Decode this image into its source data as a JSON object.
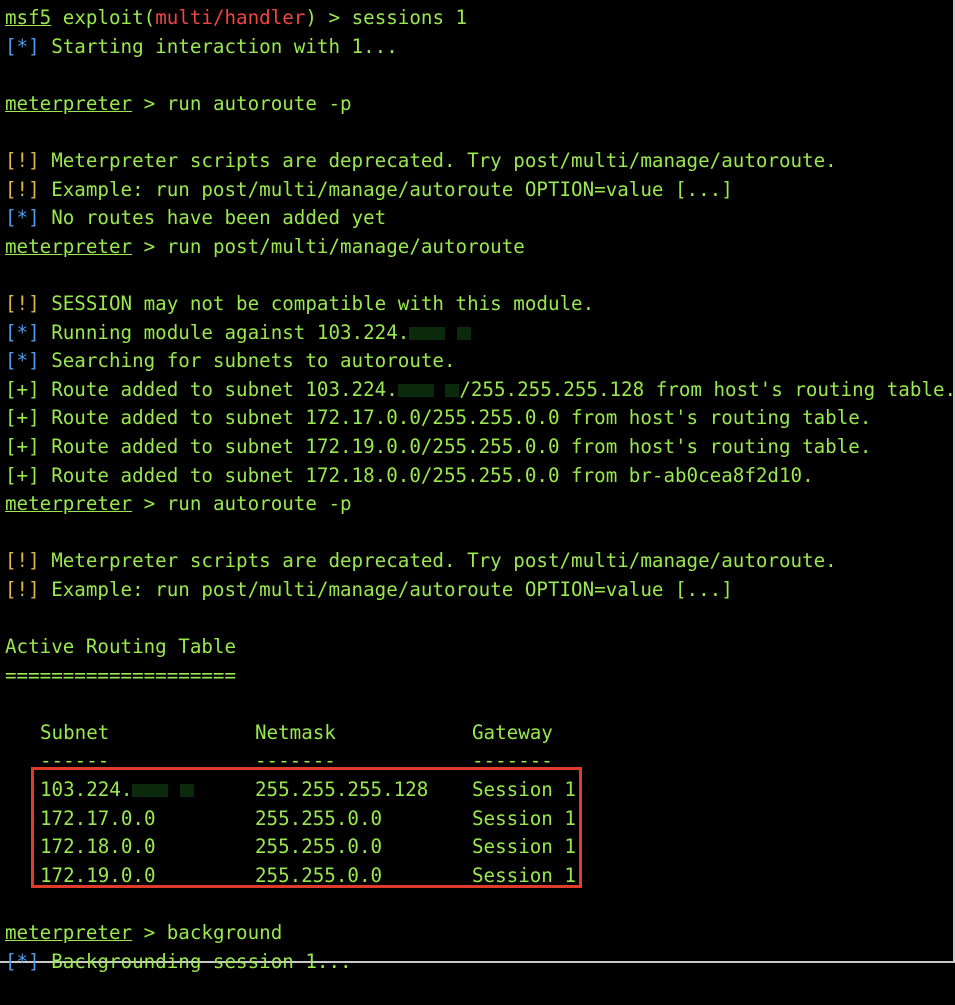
{
  "colors": {
    "background": "#000000",
    "text_green": "#9ae84f",
    "red": "#ee4444",
    "info_blue": "#4f9be8",
    "warn_yellow": "#d9b54a",
    "highlight_border": "#e03a2a"
  },
  "prompts": {
    "msf": "msf5",
    "exploit_pre": " exploit(",
    "exploit_module": "multi/handler",
    "exploit_post": ") > ",
    "meterpreter": "meterpreter",
    "mp_sep": " > "
  },
  "tags": {
    "info": "[*]",
    "warn": "[!]",
    "good": "[+]"
  },
  "lines": {
    "cmd_sessions": "sessions 1",
    "starting": " Starting interaction with 1...",
    "cmd_autoroute_p": "run autoroute -p",
    "warn_deprecated": " Meterpreter scripts are deprecated. Try post/multi/manage/autoroute.",
    "warn_example": " Example: run post/multi/manage/autoroute OPTION=value [...]",
    "no_routes": " No routes have been added yet",
    "cmd_post_autoroute": "run post/multi/manage/autoroute",
    "warn_session": " SESSION may not be compatible with this module.",
    "running_pre": " Running module against 103.224.",
    "searching": " Searching for subnets to autoroute.",
    "route1_pre": " Route added to subnet 103.224.",
    "route1_post": "/255.255.255.128 from host's routing table.",
    "route2": " Route added to subnet 172.17.0.0/255.255.0.0 from host's routing table.",
    "route3": " Route added to subnet 172.19.0.0/255.255.0.0 from host's routing table.",
    "route4": " Route added to subnet 172.18.0.0/255.255.0.0 from br-ab0cea8f2d10.",
    "cmd_autoroute_p2": "run autoroute -p",
    "warn_deprecated2": " Meterpreter scripts are deprecated. Try post/multi/manage/autoroute.",
    "warn_example2": " Example: run post/multi/manage/autoroute OPTION=value [...]",
    "table_title": "Active Routing Table",
    "table_underline": "====================",
    "cmd_background": "background",
    "backgrounding": " Backgrounding session 1..."
  },
  "routing_table": {
    "headers": [
      "Subnet",
      "Netmask",
      "Gateway"
    ],
    "header_underlines": [
      "------",
      "-------",
      "-------"
    ],
    "rows": [
      {
        "subnet": "103.224.",
        "netmask": "255.255.255.128",
        "gateway": "Session 1"
      },
      {
        "subnet": "172.17.0.0",
        "netmask": "255.255.0.0",
        "gateway": "Session 1"
      },
      {
        "subnet": "172.18.0.0",
        "netmask": "255.255.0.0",
        "gateway": "Session 1"
      },
      {
        "subnet": "172.19.0.0",
        "netmask": "255.255.0.0",
        "gateway": "Session 1"
      }
    ]
  }
}
